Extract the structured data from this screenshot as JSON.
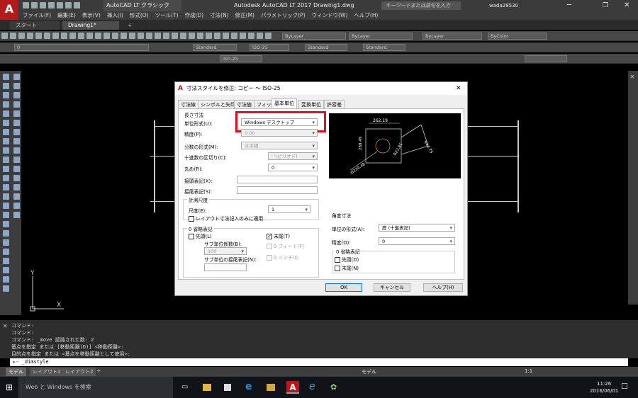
{
  "window": {
    "app_button": "A",
    "app_sub": "LT",
    "workspace": "AutoCAD LT クラシック",
    "title": "Autodesk AutoCAD LT 2017  Drawing1.dwg",
    "search_placeholder": "キーワードまたは語句を入力",
    "user": "wada28530"
  },
  "menu": [
    "ファイル(F)",
    "編集(E)",
    "表示(V)",
    "挿入(I)",
    "形式(O)",
    "ツール(T)",
    "作成(D)",
    "寸法(N)",
    "修正(M)",
    "パラメトリック(P)",
    "ウィンドウ(W)",
    "ヘルプ(H)"
  ],
  "file_tabs": [
    "スタート",
    "Drawing1*"
  ],
  "toolbar": {
    "layer_value": "0",
    "color": "ByLayer",
    "linetype": "ByLayer",
    "lineweight": "ByLayer",
    "plotstyle": "ByColor",
    "textstyle": "Standard",
    "dimstyle": "ISO-25",
    "tablestyle": "Standard",
    "mleaderstyle": "Standard",
    "dimstyle2": "ISO-25"
  },
  "dialog": {
    "title": "寸法スタイルを修正: コピー ～ ISO-25",
    "tabs": [
      "寸法線",
      "シンボルと矢印",
      "寸法値",
      "フィット",
      "基本単位",
      "変換単位",
      "許容差"
    ],
    "active_tab": "基本単位",
    "linear": {
      "group": "長さ寸法",
      "unit_format_label": "単位形式(U):",
      "unit_format": "Windows デスクトップ",
      "precision_label": "精度(P):",
      "precision": "0.00",
      "fraction_label": "分数の形式(M):",
      "fraction": "水平線",
      "decimal_sep_label": "十進数の区切り(C):",
      "decimal_sep": "' '(ピリオド)",
      "roundoff_label": "丸め(R):",
      "roundoff": "0",
      "prefix_label": "接頭表記(X):",
      "suffix_label": "接尾表記(S):"
    },
    "scale": {
      "group": "計測尺度",
      "factor_label": "尺度(E):",
      "factor": "1",
      "layout_only": "レイアウト寸法記入のみに適用"
    },
    "zero": {
      "group": "0 省略表記",
      "leading": "先頭(L)",
      "trailing": "末尾(T)",
      "sub_factor_label": "サブ単位係数(B):",
      "sub_factor": "100",
      "zero_feet": "0 フィート(F)",
      "zero_inches": "0 インチ(I)",
      "sub_suffix_label": "サブ単位の接尾表記(N):"
    },
    "angular": {
      "group": "角度寸法",
      "unit_label": "単位の形式(A):",
      "unit": "度 (十進表記)",
      "precision_label": "精度(O):",
      "precision": "0",
      "zero_group": "0 省略表記",
      "leading": "先頭(D)",
      "trailing": "末尾(N)"
    },
    "preview_labels": [
      "262.19",
      "288.49",
      "R44.75",
      "R22.81",
      "Ø229.48"
    ],
    "buttons": {
      "ok": "OK",
      "cancel": "キャンセル",
      "help": "ヘルプ(H)"
    }
  },
  "command": {
    "lines": [
      "コマンド:",
      "コマンド:",
      "コマンド: _move 認識された数: 2",
      "基点を指定 または [移動距離(D)] <移動距離>:",
      "目的点を指定 または <基点を移動距離として使用>:"
    ],
    "input": "_dimstyle"
  },
  "layout_tabs": [
    "モデル",
    "レイアウト1",
    "レイアウト2"
  ],
  "status": {
    "model": "モデル",
    "scale": "1:1"
  },
  "taskbar": {
    "search": "Web と Windows を検索",
    "time": "11:26",
    "date": "2016/06/01"
  },
  "colors": {
    "highlight": "#e0101a",
    "dialog_bg": "#f0f0f0",
    "canvas": "#000000",
    "ok_border": "#0078d7"
  }
}
